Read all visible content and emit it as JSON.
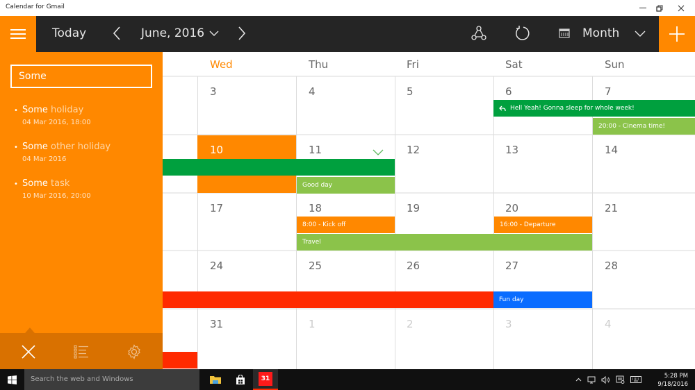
{
  "window": {
    "title": "Calendar for Gmail",
    "controls": [
      "minimize",
      "restore",
      "close"
    ]
  },
  "toolbar": {
    "today_label": "Today",
    "current_period": "June, 2016",
    "view_label": "Month",
    "icons": [
      "menu-icon",
      "chevron-left-icon",
      "chevron-down-icon",
      "chevron-right-icon",
      "share-icon",
      "refresh-icon",
      "calendar-icon",
      "add-icon"
    ]
  },
  "sidebar": {
    "search_value": "Some",
    "results": [
      {
        "match": "Some",
        "rest": " holiday",
        "date": "04 Mar 2016, 18:00"
      },
      {
        "match": "Some",
        "rest": " other holiday",
        "date": "04 Mar 2016"
      },
      {
        "match": "Some",
        "rest": " task",
        "date": "10 Mar 2016, 20:00"
      }
    ],
    "footer_icons": [
      "close-icon",
      "list-icon",
      "settings-icon"
    ]
  },
  "calendar": {
    "weekdays": [
      "Wed",
      "Thu",
      "Fri",
      "Sat",
      "Sun"
    ],
    "today_weekday": "Wed",
    "weeks": [
      {
        "days": [
          "3",
          "4",
          "5",
          "6",
          "7"
        ]
      },
      {
        "days": [
          "10",
          "11",
          "12",
          "13",
          "14"
        ]
      },
      {
        "days": [
          "17",
          "18",
          "19",
          "20",
          "21"
        ]
      },
      {
        "days": [
          "24",
          "25",
          "26",
          "27",
          "28"
        ]
      },
      {
        "days": [
          "31",
          "1",
          "2",
          "3",
          "4"
        ]
      }
    ],
    "today_date": "10",
    "events": {
      "sleep_week": {
        "label": "Hell Yeah! Gonna sleep for whole week!",
        "color": "#00a03e"
      },
      "cinema": {
        "label": "20:00 - Cinema time!",
        "color": "#8bc34a"
      },
      "green_span": {
        "label": "",
        "color": "#00a03e"
      },
      "good_day": {
        "label": "Good day",
        "color": "#8bc34a"
      },
      "kick_off": {
        "label": "8:00 - Kick off",
        "color": "#ff8800"
      },
      "departure": {
        "label": "16:00 - Departure",
        "color": "#ff8800"
      },
      "travel": {
        "label": "Travel",
        "color": "#8bc34a"
      },
      "red_span": {
        "label": "",
        "color": "#ff2a00"
      },
      "fun_day": {
        "label": "Fun day",
        "color": "#0a6cff"
      },
      "red_span_2": {
        "label": "",
        "color": "#ff2a00"
      }
    }
  },
  "taskbar": {
    "search_placeholder": "Search the web and Windows",
    "pinned_apps": [
      "file-explorer-icon",
      "store-icon",
      "calendar-app-icon"
    ],
    "calendar_app_label": "31",
    "time": "5:28 PM",
    "date": "9/18/2016"
  },
  "colors": {
    "accent": "#ff8800",
    "toolbar_bg": "#252525",
    "sidebar_footer": "#d97100"
  }
}
